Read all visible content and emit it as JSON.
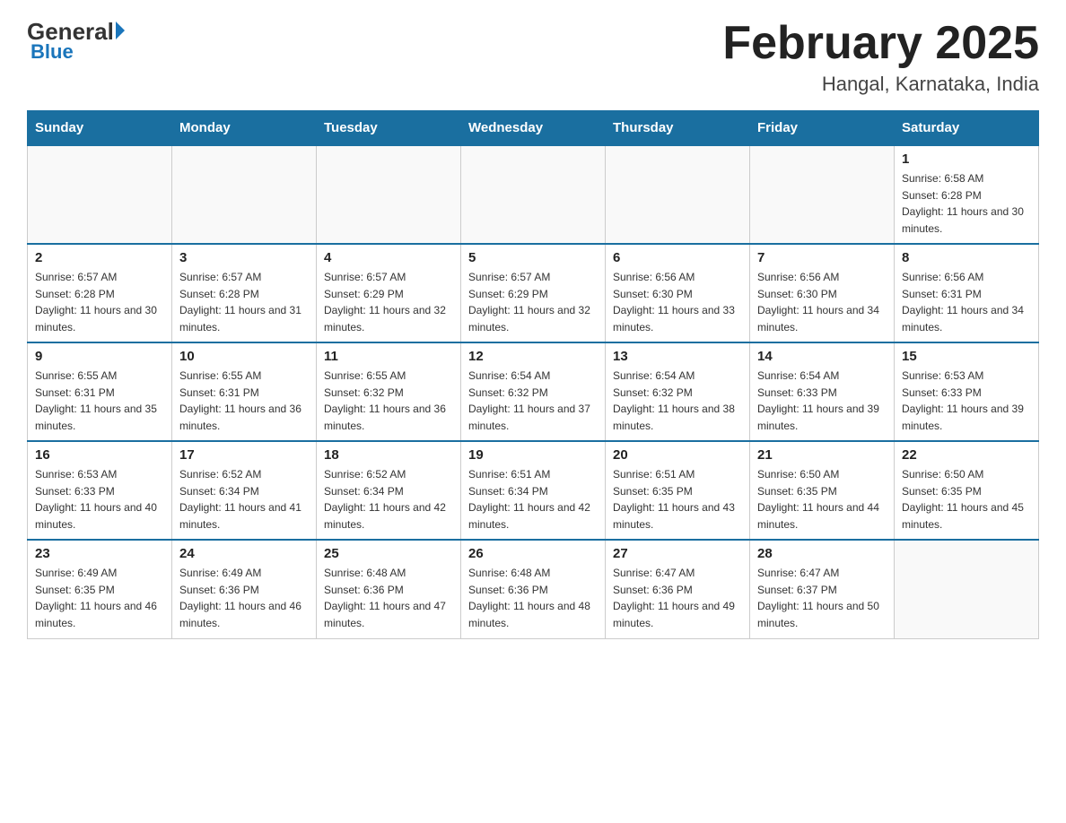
{
  "header": {
    "logo_general": "General",
    "logo_blue": "Blue",
    "month_title": "February 2025",
    "location": "Hangal, Karnataka, India"
  },
  "days_of_week": [
    "Sunday",
    "Monday",
    "Tuesday",
    "Wednesday",
    "Thursday",
    "Friday",
    "Saturday"
  ],
  "weeks": [
    [
      {
        "day": "",
        "info": ""
      },
      {
        "day": "",
        "info": ""
      },
      {
        "day": "",
        "info": ""
      },
      {
        "day": "",
        "info": ""
      },
      {
        "day": "",
        "info": ""
      },
      {
        "day": "",
        "info": ""
      },
      {
        "day": "1",
        "info": "Sunrise: 6:58 AM\nSunset: 6:28 PM\nDaylight: 11 hours and 30 minutes."
      }
    ],
    [
      {
        "day": "2",
        "info": "Sunrise: 6:57 AM\nSunset: 6:28 PM\nDaylight: 11 hours and 30 minutes."
      },
      {
        "day": "3",
        "info": "Sunrise: 6:57 AM\nSunset: 6:28 PM\nDaylight: 11 hours and 31 minutes."
      },
      {
        "day": "4",
        "info": "Sunrise: 6:57 AM\nSunset: 6:29 PM\nDaylight: 11 hours and 32 minutes."
      },
      {
        "day": "5",
        "info": "Sunrise: 6:57 AM\nSunset: 6:29 PM\nDaylight: 11 hours and 32 minutes."
      },
      {
        "day": "6",
        "info": "Sunrise: 6:56 AM\nSunset: 6:30 PM\nDaylight: 11 hours and 33 minutes."
      },
      {
        "day": "7",
        "info": "Sunrise: 6:56 AM\nSunset: 6:30 PM\nDaylight: 11 hours and 34 minutes."
      },
      {
        "day": "8",
        "info": "Sunrise: 6:56 AM\nSunset: 6:31 PM\nDaylight: 11 hours and 34 minutes."
      }
    ],
    [
      {
        "day": "9",
        "info": "Sunrise: 6:55 AM\nSunset: 6:31 PM\nDaylight: 11 hours and 35 minutes."
      },
      {
        "day": "10",
        "info": "Sunrise: 6:55 AM\nSunset: 6:31 PM\nDaylight: 11 hours and 36 minutes."
      },
      {
        "day": "11",
        "info": "Sunrise: 6:55 AM\nSunset: 6:32 PM\nDaylight: 11 hours and 36 minutes."
      },
      {
        "day": "12",
        "info": "Sunrise: 6:54 AM\nSunset: 6:32 PM\nDaylight: 11 hours and 37 minutes."
      },
      {
        "day": "13",
        "info": "Sunrise: 6:54 AM\nSunset: 6:32 PM\nDaylight: 11 hours and 38 minutes."
      },
      {
        "day": "14",
        "info": "Sunrise: 6:54 AM\nSunset: 6:33 PM\nDaylight: 11 hours and 39 minutes."
      },
      {
        "day": "15",
        "info": "Sunrise: 6:53 AM\nSunset: 6:33 PM\nDaylight: 11 hours and 39 minutes."
      }
    ],
    [
      {
        "day": "16",
        "info": "Sunrise: 6:53 AM\nSunset: 6:33 PM\nDaylight: 11 hours and 40 minutes."
      },
      {
        "day": "17",
        "info": "Sunrise: 6:52 AM\nSunset: 6:34 PM\nDaylight: 11 hours and 41 minutes."
      },
      {
        "day": "18",
        "info": "Sunrise: 6:52 AM\nSunset: 6:34 PM\nDaylight: 11 hours and 42 minutes."
      },
      {
        "day": "19",
        "info": "Sunrise: 6:51 AM\nSunset: 6:34 PM\nDaylight: 11 hours and 42 minutes."
      },
      {
        "day": "20",
        "info": "Sunrise: 6:51 AM\nSunset: 6:35 PM\nDaylight: 11 hours and 43 minutes."
      },
      {
        "day": "21",
        "info": "Sunrise: 6:50 AM\nSunset: 6:35 PM\nDaylight: 11 hours and 44 minutes."
      },
      {
        "day": "22",
        "info": "Sunrise: 6:50 AM\nSunset: 6:35 PM\nDaylight: 11 hours and 45 minutes."
      }
    ],
    [
      {
        "day": "23",
        "info": "Sunrise: 6:49 AM\nSunset: 6:35 PM\nDaylight: 11 hours and 46 minutes."
      },
      {
        "day": "24",
        "info": "Sunrise: 6:49 AM\nSunset: 6:36 PM\nDaylight: 11 hours and 46 minutes."
      },
      {
        "day": "25",
        "info": "Sunrise: 6:48 AM\nSunset: 6:36 PM\nDaylight: 11 hours and 47 minutes."
      },
      {
        "day": "26",
        "info": "Sunrise: 6:48 AM\nSunset: 6:36 PM\nDaylight: 11 hours and 48 minutes."
      },
      {
        "day": "27",
        "info": "Sunrise: 6:47 AM\nSunset: 6:36 PM\nDaylight: 11 hours and 49 minutes."
      },
      {
        "day": "28",
        "info": "Sunrise: 6:47 AM\nSunset: 6:37 PM\nDaylight: 11 hours and 50 minutes."
      },
      {
        "day": "",
        "info": ""
      }
    ]
  ]
}
